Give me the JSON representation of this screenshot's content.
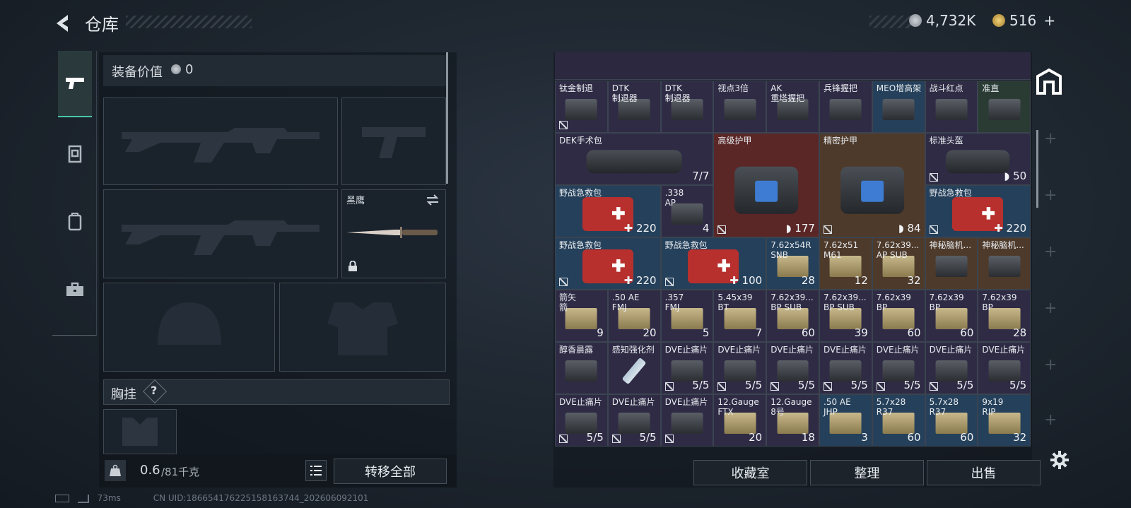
{
  "header": {
    "title": "仓库",
    "currency1": "4,732K",
    "currency2": "516",
    "plus": "+"
  },
  "colors": {
    "accent": "#47c7a8",
    "red_cell": "#5a2626",
    "blue_cell": "#25405a",
    "gold_cell": "#4e3a2a"
  },
  "tabs": [
    {
      "icon": "pistol-icon",
      "active": true
    },
    {
      "icon": "armor-vest-icon",
      "active": false
    },
    {
      "icon": "backpack-icon",
      "active": false
    },
    {
      "icon": "toolbox-icon",
      "active": false
    }
  ],
  "equipment": {
    "value_label": "装备价值",
    "value": "0",
    "knife_label": "黑鹰",
    "chest_label": "胸挂",
    "chest_help": "?",
    "weight": "0.6",
    "weight_max": "/81千克",
    "transfer_all": "转移全部"
  },
  "grid": {
    "items": [
      {
        "name": "钛金制退",
        "count": "",
        "locked": true,
        "col": 0,
        "row": 0,
        "w": 1,
        "h": 1,
        "tint": "p",
        "art": "gray"
      },
      {
        "name": "DTK\n制退器",
        "count": "",
        "locked": false,
        "col": 1,
        "row": 0,
        "w": 1,
        "h": 1,
        "tint": "p",
        "art": "gray"
      },
      {
        "name": "DTK\n制退器",
        "count": "",
        "locked": false,
        "col": 2,
        "row": 0,
        "w": 1,
        "h": 1,
        "tint": "p",
        "art": "gray"
      },
      {
        "name": "视点3倍",
        "count": "",
        "locked": false,
        "col": 3,
        "row": 0,
        "w": 1,
        "h": 1,
        "tint": "p",
        "art": "gray"
      },
      {
        "name": "AK\n重塔握把",
        "count": "",
        "locked": false,
        "col": 4,
        "row": 0,
        "w": 1,
        "h": 1,
        "tint": "p",
        "art": "gray"
      },
      {
        "name": "兵锋握把",
        "count": "",
        "locked": false,
        "col": 5,
        "row": 0,
        "w": 1,
        "h": 1,
        "tint": "p",
        "art": "gray"
      },
      {
        "name": "MEO增高架",
        "count": "",
        "locked": false,
        "col": 6,
        "row": 0,
        "w": 1,
        "h": 1,
        "tint": "b",
        "art": "gray"
      },
      {
        "name": "战斗红点",
        "count": "",
        "locked": false,
        "col": 7,
        "row": 0,
        "w": 1,
        "h": 1,
        "tint": "p",
        "art": "gray"
      },
      {
        "name": "准直",
        "count": "",
        "locked": false,
        "col": 8,
        "row": 0,
        "w": 1,
        "h": 1,
        "tint": "g",
        "art": "gray"
      },
      {
        "name": "DEK手术包",
        "count": "7/7",
        "locked": false,
        "col": 0,
        "row": 1,
        "w": 3,
        "h": 1,
        "tint": "p",
        "art": "bag"
      },
      {
        "name": "高级护甲",
        "count": "177",
        "locked": true,
        "col": 3,
        "row": 1,
        "w": 2,
        "h": 2,
        "tint": "r",
        "art": "bag",
        "shield": true
      },
      {
        "name": "精密护甲",
        "count": "84",
        "locked": true,
        "col": 5,
        "row": 1,
        "w": 2,
        "h": 2,
        "tint": "o",
        "art": "bag",
        "shield": true
      },
      {
        "name": "标准头盔",
        "count": "50",
        "locked": true,
        "col": 7,
        "row": 1,
        "w": 2,
        "h": 1,
        "tint": "p",
        "art": "bag",
        "shield": true
      },
      {
        "name": "野战急救包",
        "count": "220",
        "locked": false,
        "col": 0,
        "row": 2,
        "w": 2,
        "h": 1,
        "tint": "b",
        "art": "med",
        "heal": true
      },
      {
        "name": ".338\nAP",
        "count": "4",
        "locked": false,
        "col": 2,
        "row": 2,
        "w": 1,
        "h": 1,
        "tint": "p",
        "art": "gray"
      },
      {
        "name": "野战急救包",
        "count": "220",
        "locked": true,
        "col": 7,
        "row": 2,
        "w": 2,
        "h": 1,
        "tint": "b",
        "art": "med",
        "heal": true
      },
      {
        "name": "野战急救包",
        "count": "220",
        "locked": true,
        "col": 0,
        "row": 3,
        "w": 2,
        "h": 1,
        "tint": "b",
        "art": "med",
        "heal": true
      },
      {
        "name": "野战急救包",
        "count": "100",
        "locked": true,
        "col": 2,
        "row": 3,
        "w": 2,
        "h": 1,
        "tint": "b",
        "art": "med",
        "heal": true
      },
      {
        "name": "7.62x54R\nSNB",
        "count": "28",
        "locked": false,
        "col": 4,
        "row": 3,
        "w": 1,
        "h": 1,
        "tint": "b",
        "art": "box"
      },
      {
        "name": "7.62x51\nM61",
        "count": "12",
        "locked": false,
        "col": 5,
        "row": 3,
        "w": 1,
        "h": 1,
        "tint": "o",
        "art": "box"
      },
      {
        "name": "7.62x39...\nAP SUB",
        "count": "32",
        "locked": false,
        "col": 6,
        "row": 3,
        "w": 1,
        "h": 1,
        "tint": "o",
        "art": "box"
      },
      {
        "name": "神秘脑机...",
        "count": "",
        "locked": false,
        "col": 7,
        "row": 3,
        "w": 1,
        "h": 1,
        "tint": "o",
        "art": "gray"
      },
      {
        "name": "神秘脑机...",
        "count": "",
        "locked": false,
        "col": 8,
        "row": 3,
        "w": 1,
        "h": 1,
        "tint": "o",
        "art": "gray"
      },
      {
        "name": "箭矢\n箭",
        "count": "9",
        "locked": false,
        "col": 0,
        "row": 4,
        "w": 1,
        "h": 1,
        "tint": "p",
        "art": "box"
      },
      {
        "name": ".50 AE\nFMJ",
        "count": "20",
        "locked": false,
        "col": 1,
        "row": 4,
        "w": 1,
        "h": 1,
        "tint": "p",
        "art": "box"
      },
      {
        "name": ".357\nFMJ",
        "count": "5",
        "locked": false,
        "col": 2,
        "row": 4,
        "w": 1,
        "h": 1,
        "tint": "p",
        "art": "box"
      },
      {
        "name": "5.45x39\nBT",
        "count": "7",
        "locked": false,
        "col": 3,
        "row": 4,
        "w": 1,
        "h": 1,
        "tint": "p",
        "art": "box"
      },
      {
        "name": "7.62x39...\nBP SUB",
        "count": "60",
        "locked": false,
        "col": 4,
        "row": 4,
        "w": 1,
        "h": 1,
        "tint": "p",
        "art": "box"
      },
      {
        "name": "7.62x39...\nBP SUB",
        "count": "39",
        "locked": false,
        "col": 5,
        "row": 4,
        "w": 1,
        "h": 1,
        "tint": "p",
        "art": "box"
      },
      {
        "name": "7.62x39\nBP",
        "count": "60",
        "locked": false,
        "col": 6,
        "row": 4,
        "w": 1,
        "h": 1,
        "tint": "p",
        "art": "box"
      },
      {
        "name": "7.62x39\nBP",
        "count": "60",
        "locked": false,
        "col": 7,
        "row": 4,
        "w": 1,
        "h": 1,
        "tint": "p",
        "art": "box"
      },
      {
        "name": "7.62x39\nBP",
        "count": "28",
        "locked": false,
        "col": 8,
        "row": 4,
        "w": 1,
        "h": 1,
        "tint": "p",
        "art": "box"
      },
      {
        "name": "醇香晨露",
        "count": "",
        "locked": false,
        "col": 0,
        "row": 5,
        "w": 1,
        "h": 1,
        "tint": "p",
        "art": "gray"
      },
      {
        "name": "感知强化剂",
        "count": "",
        "locked": false,
        "col": 1,
        "row": 5,
        "w": 1,
        "h": 1,
        "tint": "p",
        "art": "pen"
      },
      {
        "name": "DVE止痛片",
        "count": "5/5",
        "locked": true,
        "col": 2,
        "row": 5,
        "w": 1,
        "h": 1,
        "tint": "p",
        "art": "gray"
      },
      {
        "name": "DVE止痛片",
        "count": "5/5",
        "locked": true,
        "col": 3,
        "row": 5,
        "w": 1,
        "h": 1,
        "tint": "p",
        "art": "gray"
      },
      {
        "name": "DVE止痛片",
        "count": "5/5",
        "locked": true,
        "col": 4,
        "row": 5,
        "w": 1,
        "h": 1,
        "tint": "p",
        "art": "gray"
      },
      {
        "name": "DVE止痛片",
        "count": "5/5",
        "locked": true,
        "col": 5,
        "row": 5,
        "w": 1,
        "h": 1,
        "tint": "p",
        "art": "gray"
      },
      {
        "name": "DVE止痛片",
        "count": "5/5",
        "locked": true,
        "col": 6,
        "row": 5,
        "w": 1,
        "h": 1,
        "tint": "p",
        "art": "gray"
      },
      {
        "name": "DVE止痛片",
        "count": "5/5",
        "locked": true,
        "col": 7,
        "row": 5,
        "w": 1,
        "h": 1,
        "tint": "p",
        "art": "gray"
      },
      {
        "name": "DVE止痛片",
        "count": "5/5",
        "locked": false,
        "col": 8,
        "row": 5,
        "w": 1,
        "h": 1,
        "tint": "p",
        "art": "gray"
      },
      {
        "name": "DVE止痛片",
        "count": "5/5",
        "locked": true,
        "col": 0,
        "row": 6,
        "w": 1,
        "h": 1,
        "tint": "p",
        "art": "gray"
      },
      {
        "name": "DVE止痛片",
        "count": "5/5",
        "locked": true,
        "col": 1,
        "row": 6,
        "w": 1,
        "h": 1,
        "tint": "p",
        "art": "gray"
      },
      {
        "name": "DVE止痛片",
        "count": "",
        "locked": true,
        "col": 2,
        "row": 6,
        "w": 1,
        "h": 1,
        "tint": "p",
        "art": "gray"
      },
      {
        "name": "12.Gauge\nFTX",
        "count": "20",
        "locked": false,
        "col": 3,
        "row": 6,
        "w": 1,
        "h": 1,
        "tint": "p",
        "art": "box"
      },
      {
        "name": "12.Gauge\n8号",
        "count": "18",
        "locked": false,
        "col": 4,
        "row": 6,
        "w": 1,
        "h": 1,
        "tint": "p",
        "art": "box"
      },
      {
        "name": ".50 AE\nJHP",
        "count": "3",
        "locked": false,
        "col": 5,
        "row": 6,
        "w": 1,
        "h": 1,
        "tint": "b",
        "art": "box"
      },
      {
        "name": "5.7x28\nR37",
        "count": "60",
        "locked": false,
        "col": 6,
        "row": 6,
        "w": 1,
        "h": 1,
        "tint": "b",
        "art": "box"
      },
      {
        "name": "5.7x28\nR37",
        "count": "60",
        "locked": false,
        "col": 7,
        "row": 6,
        "w": 1,
        "h": 1,
        "tint": "b",
        "art": "box"
      },
      {
        "name": "9x19\nRIP",
        "count": "32",
        "locked": false,
        "col": 8,
        "row": 6,
        "w": 1,
        "h": 1,
        "tint": "b",
        "art": "box"
      }
    ]
  },
  "bottom_buttons": {
    "collection": "收藏室",
    "sort": "整理",
    "sell": "出售"
  },
  "status": {
    "ping": "73ms",
    "uid": "CN UID:186654176225158163744_202606092101"
  }
}
